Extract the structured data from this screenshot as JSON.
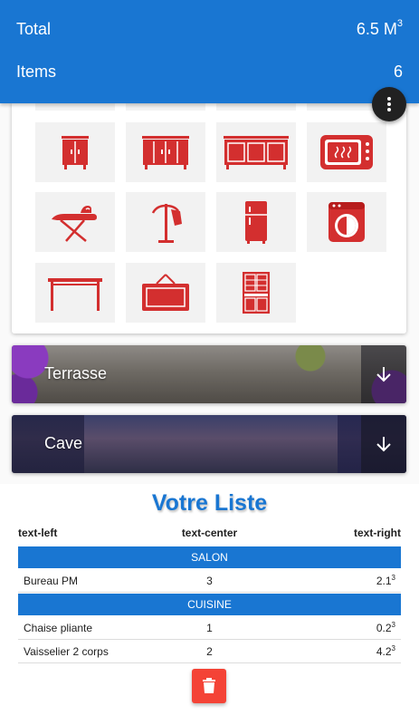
{
  "header": {
    "total_label": "Total",
    "total_value": "6.5 M",
    "total_unit_exp": "3",
    "items_label": "Items",
    "items_value": "6",
    "color": "#1976d2"
  },
  "menu_button": {
    "icon": "more-vert-icon"
  },
  "furniture_icons": [
    "cabinet-icon",
    "sideboard-icon",
    "buffet-icon",
    "microwave-icon",
    "ironing-board-icon",
    "coat-rack-icon",
    "refrigerator-icon",
    "washing-machine-icon",
    "table-icon",
    "mirror-frame-icon",
    "china-cabinet-icon"
  ],
  "icon_color": "#d32f2f",
  "rooms": [
    {
      "label": "Terrasse",
      "icon": "arrow-down-icon"
    },
    {
      "label": "Cave",
      "icon": "arrow-down-icon"
    }
  ],
  "list": {
    "title": "Votre Liste",
    "columns": [
      "text-left",
      "text-center",
      "text-right"
    ],
    "sections": [
      {
        "name": "SALON",
        "rows": [
          {
            "name": "Bureau PM",
            "qty": "3",
            "volume": "2.1",
            "exp": "3"
          }
        ]
      },
      {
        "name": "CUISINE",
        "rows": [
          {
            "name": "Chaise pliante",
            "qty": "1",
            "volume": "0.2",
            "exp": "3"
          },
          {
            "name": "Vaisselier 2 corps",
            "qty": "2",
            "volume": "4.2",
            "exp": "3"
          }
        ]
      }
    ]
  },
  "delete_button": {
    "icon": "trash-icon",
    "color": "#f44336"
  }
}
